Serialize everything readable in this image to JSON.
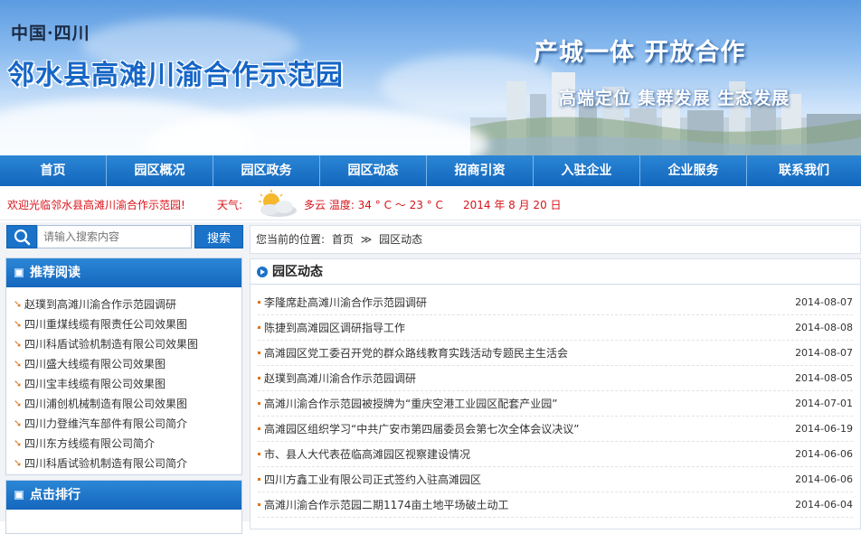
{
  "banner": {
    "country": "中国·四川",
    "title": "邻水县高滩川渝合作示范园",
    "slogan_main": "产城一体  开放合作",
    "slogan_sub": "高端定位  集群发展  生态发展"
  },
  "nav": {
    "items": [
      "首页",
      "园区概况",
      "园区政务",
      "园区动态",
      "招商引资",
      "入驻企业",
      "企业服务",
      "联系我们"
    ]
  },
  "info": {
    "welcome": "欢迎光临邻水县高滩川渝合作示范园!",
    "weather_label": "天气:",
    "weather_text": "多云 温度: 34 ° C ～ 23 ° C",
    "date": "2014 年 8 月 20 日"
  },
  "search": {
    "placeholder": "请输入搜索内容",
    "button": "搜索"
  },
  "breadcrumb": {
    "prefix": "您当前的位置:",
    "home": "首页",
    "sep": "≫",
    "current": "园区动态"
  },
  "recommend": {
    "title": "推荐阅读",
    "items": [
      "赵璞到高滩川渝合作示范园调研",
      "四川重煤线缆有限责任公司效果图",
      "四川科盾试验机制造有限公司效果图",
      "四川盛大线缆有限公司效果图",
      "四川宝丰线缆有限公司效果图",
      "四川浦创机械制造有限公司效果图",
      "四川力登维汽车部件有限公司简介",
      "四川东方线缆有限公司简介",
      "四川科盾试验机制造有限公司简介"
    ]
  },
  "ranking": {
    "title": "点击排行"
  },
  "news": {
    "title": "园区动态",
    "items": [
      {
        "title": "李隆席赴高滩川渝合作示范园调研",
        "date": "2014-08-07"
      },
      {
        "title": "陈捷到高滩园区调研指导工作",
        "date": "2014-08-08"
      },
      {
        "title": "高滩园区党工委召开党的群众路线教育实践活动专题民主生活会",
        "date": "2014-08-07"
      },
      {
        "title": "赵璞到高滩川渝合作示范园调研",
        "date": "2014-08-05"
      },
      {
        "title": "高滩川渝合作示范园被授牌为“重庆空港工业园区配套产业园”",
        "date": "2014-07-01"
      },
      {
        "title": "高滩园区组织学习“中共广安市第四届委员会第七次全体会议决议”",
        "date": "2014-06-19"
      },
      {
        "title": "市、县人大代表莅临高滩园区视察建设情况",
        "date": "2014-06-06"
      },
      {
        "title": "四川方鑫工业有限公司正式签约入驻高滩园区",
        "date": "2014-06-06"
      },
      {
        "title": "高滩川渝合作示范园二期1174亩土地平场破土动工",
        "date": "2014-06-04"
      }
    ]
  },
  "colors": {
    "brand_blue": "#1a72c9",
    "title_blue": "#1666c6",
    "alert_red": "#d8141b",
    "bullet_orange": "#e1741b"
  },
  "icons": {
    "search": "search-icon",
    "weather": "partly-cloudy-icon",
    "list_arrow": "arrow-right-icon"
  }
}
